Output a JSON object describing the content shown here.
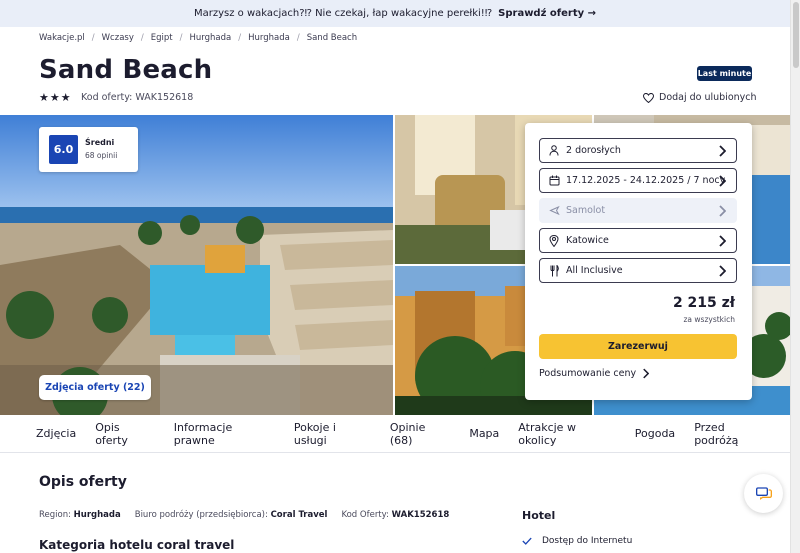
{
  "banner": {
    "text": "Marzysz o wakacjach?⁉ Nie czekaj, łap wakacyjne perełki!⁉",
    "cta": "Sprawdź oferty →"
  },
  "breadcrumb": [
    "Wakacje.pl",
    "Wczasy",
    "Egipt",
    "Hurghada",
    "Hurghada",
    "Sand Beach"
  ],
  "hotel": {
    "name": "Sand Beach",
    "badge": "Last minute",
    "stars": "★★★",
    "offer_code": "Kod oferty: WAK152618",
    "favorite": "Dodaj do ulubionych"
  },
  "rating": {
    "score": "6.0",
    "label": "Średni",
    "opinions": "68 opinii"
  },
  "gallery": {
    "photos_button": "Zdjęcia oferty (22)"
  },
  "booking": {
    "persons": "2 dorosłych",
    "dates": "17.12.2025 - 24.12.2025 / 7 nocy",
    "transport": "Samolot",
    "departure": "Katowice",
    "board": "All Inclusive",
    "price": "2 215 zł",
    "price_note": "za wszystkich",
    "reserve": "Zarezerwuj",
    "summary": "Podsumowanie ceny"
  },
  "nav": [
    "Zdjęcia",
    "Opis oferty",
    "Informacje prawne",
    "Pokoje i usługi",
    "Opinie (68)",
    "Mapa",
    "Atrakcje w okolicy",
    "Pogoda",
    "Przed podróżą"
  ],
  "description": {
    "title": "Opis oferty",
    "region_label": "Region:",
    "region": "Hurghada",
    "agency_label": "Biuro podróży (przedsiębiorca):",
    "agency": "Coral Travel",
    "code_label": "Kod Oferty:",
    "code": "WAK152618",
    "category_title": "Kategoria hotelu coral travel"
  },
  "hotel_section": {
    "title": "Hotel",
    "feature": "Dostęp do Internetu"
  },
  "colors": {
    "brand": "#1a45b4",
    "cta": "#f7c332",
    "badge": "#0b2a5b"
  }
}
